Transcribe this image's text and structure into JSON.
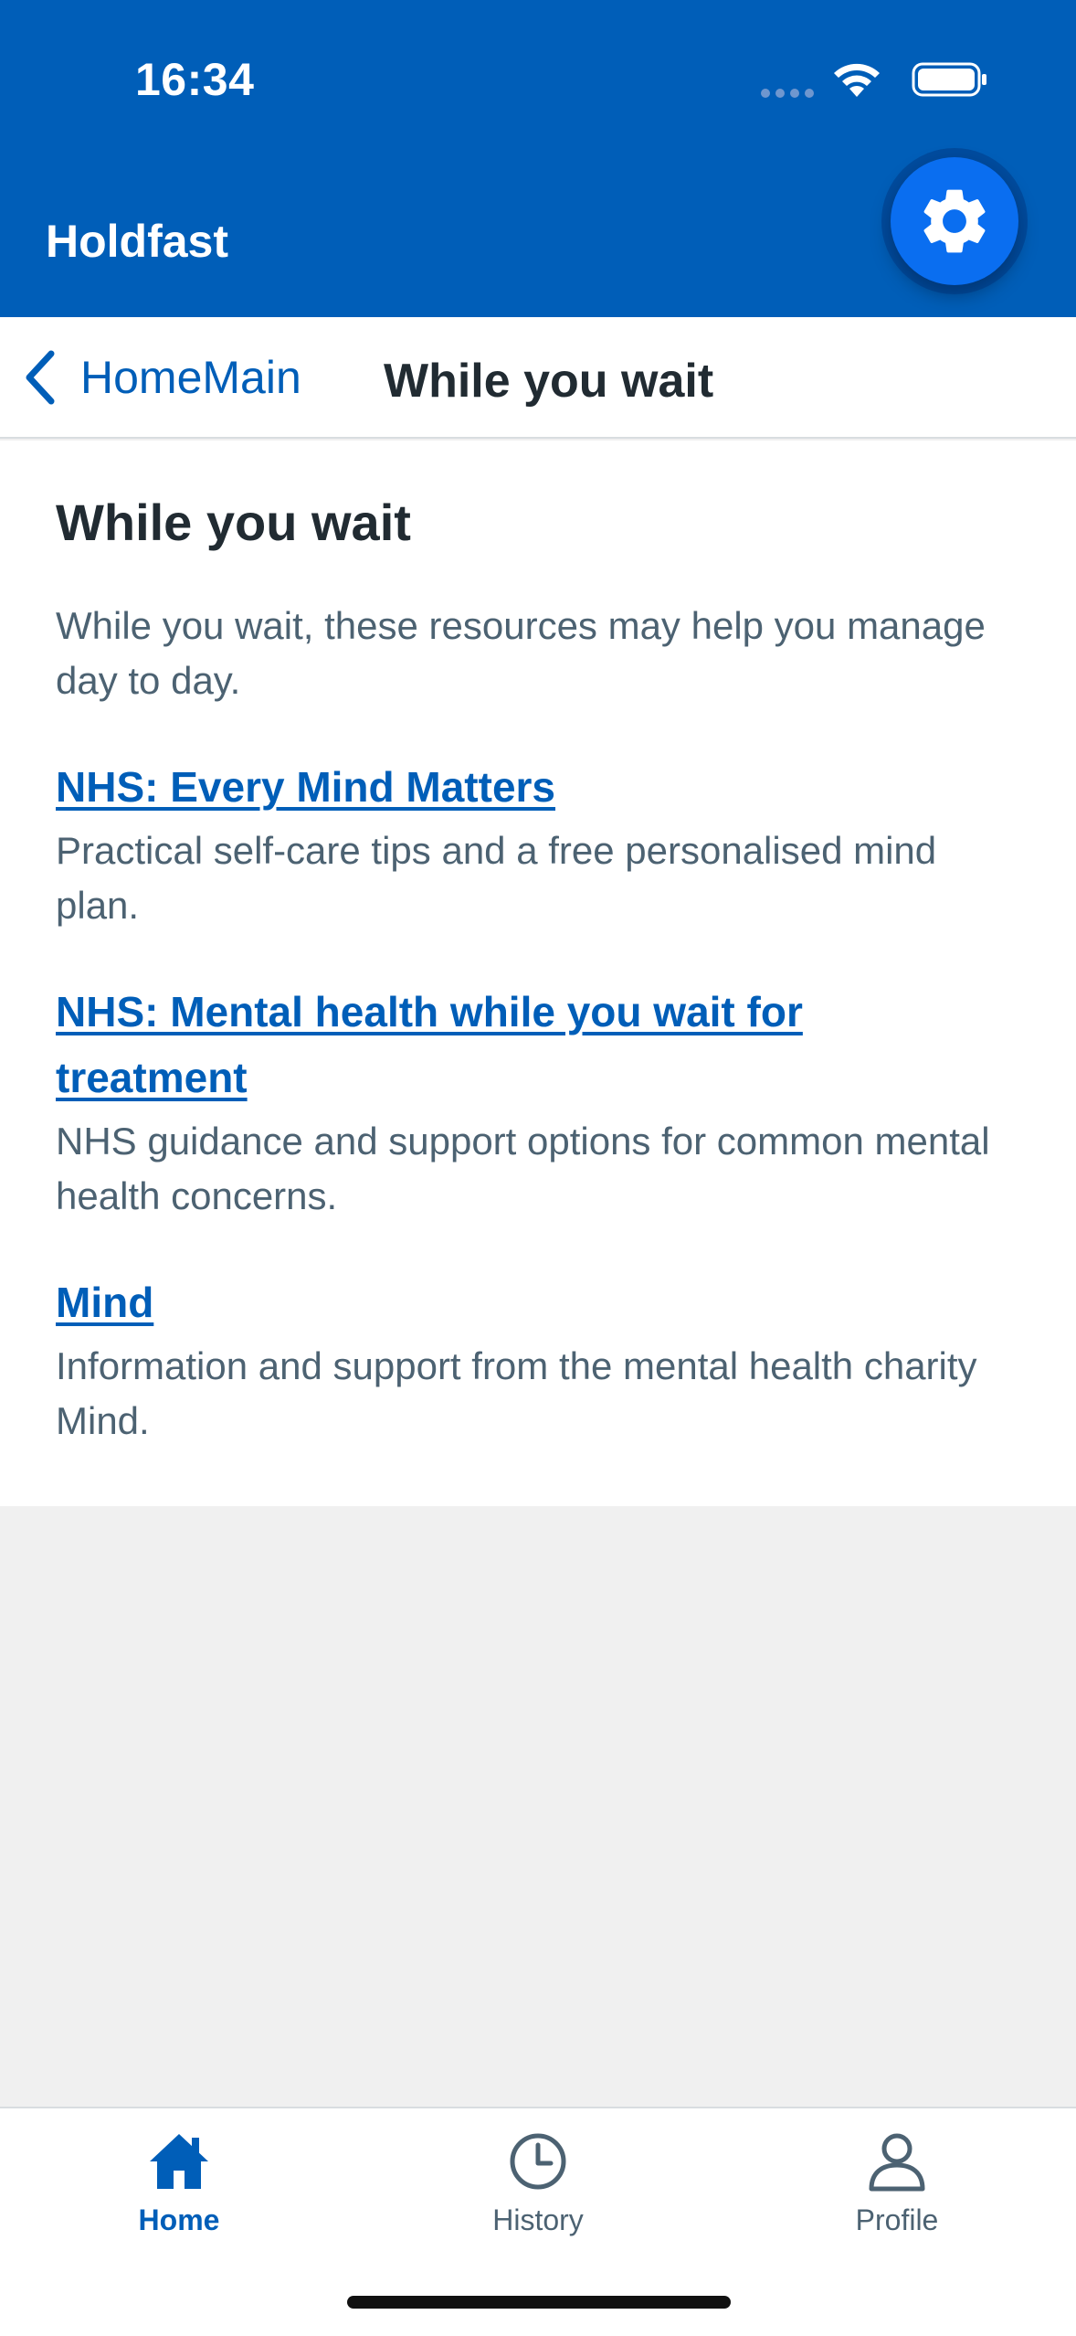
{
  "status_bar": {
    "time": "16:34",
    "icons": [
      "signal-dots-icon",
      "wifi-icon",
      "battery-icon"
    ]
  },
  "app_bar": {
    "title": "Holdfast",
    "settings_icon": "gear-icon",
    "color": "#005eb8"
  },
  "nav": {
    "back_label": "HomeMain",
    "title": "While you wait"
  },
  "content": {
    "heading": "While you wait",
    "intro": "While you wait, these resources may help you manage day to day.",
    "resources": [
      {
        "title": "NHS: Every Mind Matters",
        "description": "Practical self-care tips and a free personalised mind plan."
      },
      {
        "title": "NHS: Mental health while you wait for treatment",
        "description": "NHS guidance and support options for common mental health concerns."
      },
      {
        "title": "Mind",
        "description": "Information and support from the mental health charity Mind."
      }
    ]
  },
  "tabs": [
    {
      "label": "Home",
      "icon": "home-icon",
      "active": true
    },
    {
      "label": "History",
      "icon": "clock-icon",
      "active": false
    },
    {
      "label": "Profile",
      "icon": "person-icon",
      "active": false
    }
  ],
  "colors": {
    "brand": "#005eb8",
    "link": "#005eb8",
    "text_primary": "#212b32",
    "text_secondary": "#4c6272",
    "background": "#f0f0f0"
  }
}
